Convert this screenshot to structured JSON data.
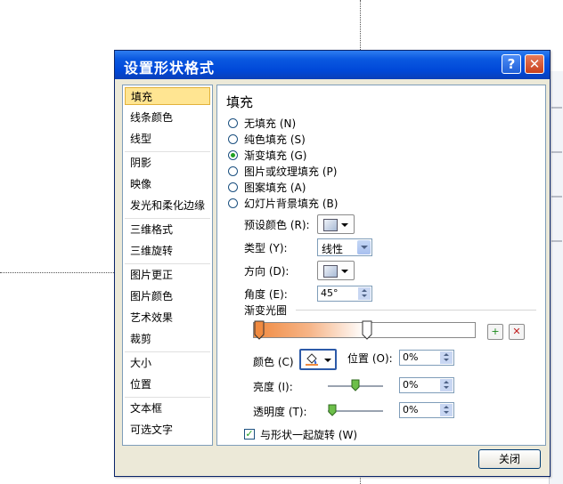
{
  "dialog": {
    "title": "设置形状格式",
    "help_glyph": "?",
    "close_glyph": "✕",
    "close_button": "关闭"
  },
  "nav": {
    "items": [
      "填充",
      "线条颜色",
      "线型",
      "阴影",
      "映像",
      "发光和柔化边缘",
      "三维格式",
      "三维旋转",
      "图片更正",
      "图片颜色",
      "艺术效果",
      "裁剪",
      "大小",
      "位置",
      "文本框",
      "可选文字"
    ],
    "selected": "填充"
  },
  "fill": {
    "heading": "填充",
    "options": [
      "无填充 (N)",
      "纯色填充 (S)",
      "渐变填充 (G)",
      "图片或纹理填充 (P)",
      "图案填充 (A)",
      "幻灯片背景填充 (B)"
    ],
    "selected_option": "渐变填充 (G)",
    "preset_label": "预设颜色 (R):",
    "type_label": "类型 (Y):",
    "type_value": "线性",
    "direction_label": "方向 (D):",
    "angle_label": "角度 (E):",
    "angle_value": "45°",
    "stops_label": "渐变光圈",
    "color_label": "颜色 (C)",
    "position_label": "位置 (O):",
    "position_value": "0%",
    "brightness_label": "亮度 (I):",
    "brightness_value": "0%",
    "transparency_label": "透明度 (T):",
    "transparency_value": "0%",
    "rotate_label": "与形状一起旋转 (W)",
    "rotate_checked": true,
    "add_stop_glyph": "+",
    "remove_stop_glyph": "✕",
    "gradient_colors": [
      "#f08a40",
      "#ffffff"
    ]
  }
}
